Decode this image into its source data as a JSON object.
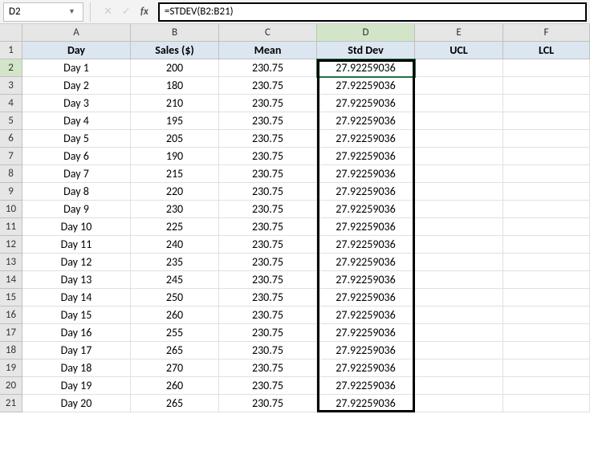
{
  "nameBox": {
    "value": "D2"
  },
  "formulaBar": {
    "value": "=STDEV(B2:B21)"
  },
  "fxLabel": "fx",
  "columnHeaders": [
    "A",
    "B",
    "C",
    "D",
    "E",
    "F"
  ],
  "rowHeaders": [
    "1",
    "2",
    "3",
    "4",
    "5",
    "6",
    "7",
    "8",
    "9",
    "10",
    "11",
    "12",
    "13",
    "14",
    "15",
    "16",
    "17",
    "18",
    "19",
    "20",
    "21"
  ],
  "table": {
    "headers": {
      "A": "Day",
      "B": "Sales ($)",
      "C": "Mean",
      "D": "Std Dev",
      "E": "UCL",
      "F": "LCL"
    },
    "rows": [
      {
        "A": "Day 1",
        "B": "200",
        "C": "230.75",
        "D": "27.92259036",
        "E": "",
        "F": ""
      },
      {
        "A": "Day 2",
        "B": "180",
        "C": "230.75",
        "D": "27.92259036",
        "E": "",
        "F": ""
      },
      {
        "A": "Day 3",
        "B": "210",
        "C": "230.75",
        "D": "27.92259036",
        "E": "",
        "F": ""
      },
      {
        "A": "Day 4",
        "B": "195",
        "C": "230.75",
        "D": "27.92259036",
        "E": "",
        "F": ""
      },
      {
        "A": "Day 5",
        "B": "205",
        "C": "230.75",
        "D": "27.92259036",
        "E": "",
        "F": ""
      },
      {
        "A": "Day 6",
        "B": "190",
        "C": "230.75",
        "D": "27.92259036",
        "E": "",
        "F": ""
      },
      {
        "A": "Day 7",
        "B": "215",
        "C": "230.75",
        "D": "27.92259036",
        "E": "",
        "F": ""
      },
      {
        "A": "Day 8",
        "B": "220",
        "C": "230.75",
        "D": "27.92259036",
        "E": "",
        "F": ""
      },
      {
        "A": "Day 9",
        "B": "230",
        "C": "230.75",
        "D": "27.92259036",
        "E": "",
        "F": ""
      },
      {
        "A": "Day 10",
        "B": "225",
        "C": "230.75",
        "D": "27.92259036",
        "E": "",
        "F": ""
      },
      {
        "A": "Day 11",
        "B": "240",
        "C": "230.75",
        "D": "27.92259036",
        "E": "",
        "F": ""
      },
      {
        "A": "Day 12",
        "B": "235",
        "C": "230.75",
        "D": "27.92259036",
        "E": "",
        "F": ""
      },
      {
        "A": "Day 13",
        "B": "245",
        "C": "230.75",
        "D": "27.92259036",
        "E": "",
        "F": ""
      },
      {
        "A": "Day 14",
        "B": "250",
        "C": "230.75",
        "D": "27.92259036",
        "E": "",
        "F": ""
      },
      {
        "A": "Day 15",
        "B": "260",
        "C": "230.75",
        "D": "27.92259036",
        "E": "",
        "F": ""
      },
      {
        "A": "Day 16",
        "B": "255",
        "C": "230.75",
        "D": "27.92259036",
        "E": "",
        "F": ""
      },
      {
        "A": "Day 17",
        "B": "265",
        "C": "230.75",
        "D": "27.92259036",
        "E": "",
        "F": ""
      },
      {
        "A": "Day 18",
        "B": "270",
        "C": "230.75",
        "D": "27.92259036",
        "E": "",
        "F": ""
      },
      {
        "A": "Day 19",
        "B": "260",
        "C": "230.75",
        "D": "27.92259036",
        "E": "",
        "F": ""
      },
      {
        "A": "Day 20",
        "B": "265",
        "C": "230.75",
        "D": "27.92259036",
        "E": "",
        "F": ""
      }
    ]
  },
  "activeCell": {
    "row": 2,
    "col": "D"
  },
  "activeColumn": "D",
  "activeRow": 2
}
